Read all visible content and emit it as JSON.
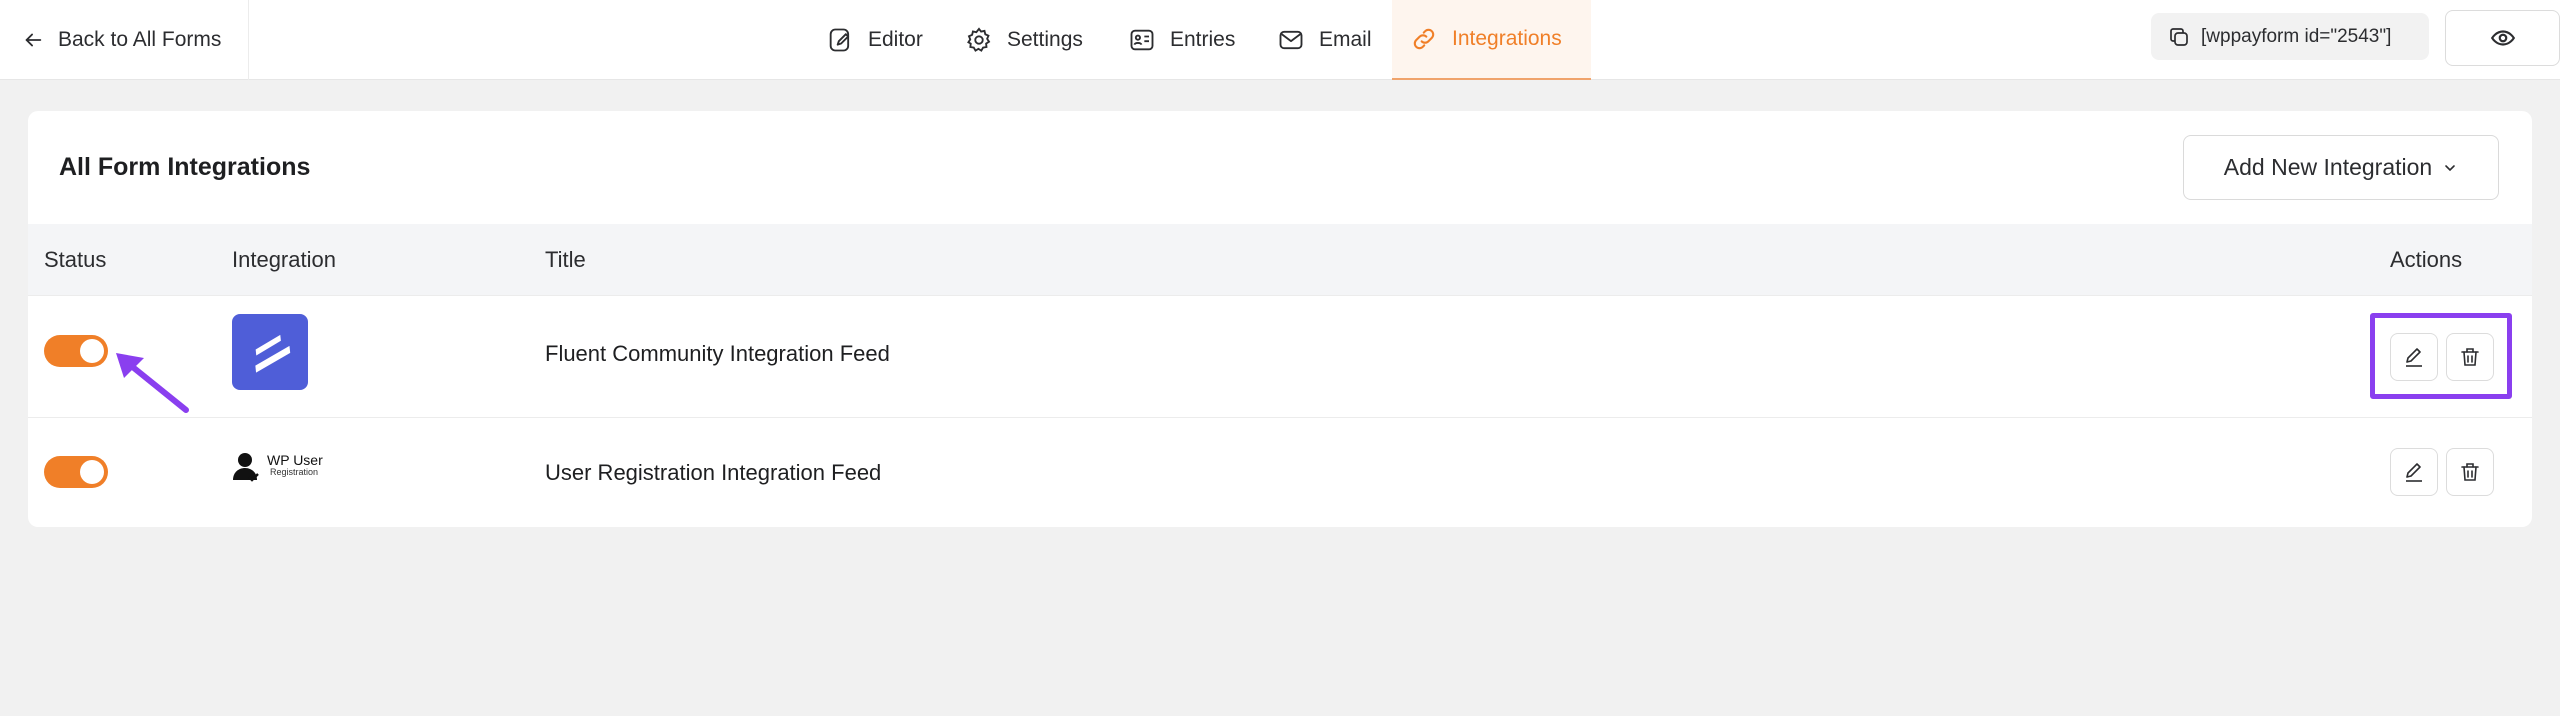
{
  "topbar": {
    "back_label": "Back to All Forms",
    "nav": [
      {
        "label": "Editor",
        "icon": "editor-icon"
      },
      {
        "label": "Settings",
        "icon": "gear-icon"
      },
      {
        "label": "Entries",
        "icon": "entries-icon"
      },
      {
        "label": "Email",
        "icon": "mail-icon"
      },
      {
        "label": "Integrations",
        "icon": "link-icon",
        "active": true
      }
    ],
    "shortcode": "[wppayform id=\"2543\"]"
  },
  "card": {
    "title": "All Form Integrations",
    "add_button": "Add New Integration",
    "columns": {
      "status": "Status",
      "integration": "Integration",
      "title": "Title",
      "actions": "Actions"
    },
    "rows": [
      {
        "status_on": true,
        "integration_logo": "fluent-community-logo",
        "title": "Fluent Community Integration Feed"
      },
      {
        "status_on": true,
        "integration_logo": "wp-user-registration-logo",
        "logo_text_1": "WP User",
        "logo_text_2": "Registration",
        "title": "User Registration Integration Feed"
      }
    ]
  },
  "colors": {
    "accent": "#f07f28",
    "annotation": "#8a3fef",
    "fluent_logo_bg": "#4f5ed8"
  }
}
